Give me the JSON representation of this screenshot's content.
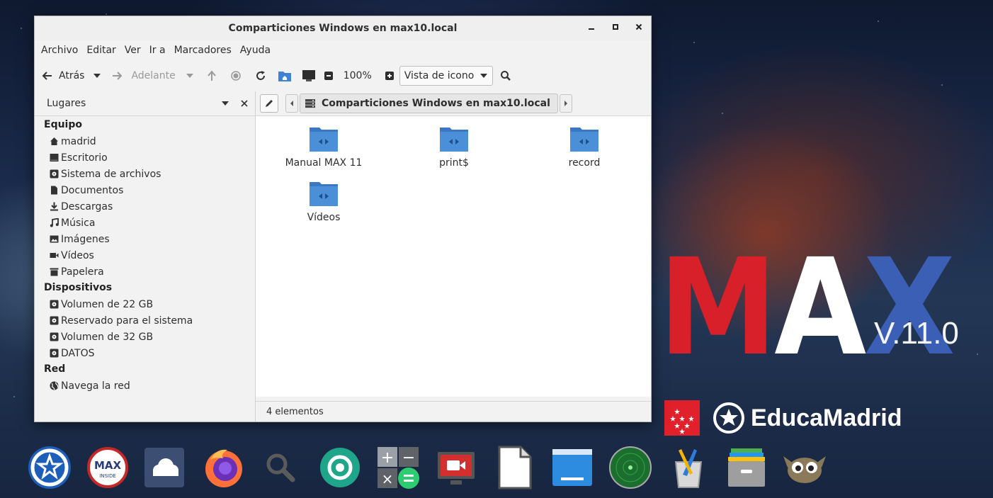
{
  "window": {
    "title": "Comparticiones Windows en max10.local",
    "controls": {
      "minimize": "–",
      "maximize": "▪",
      "close": "×"
    }
  },
  "menubar": [
    "Archivo",
    "Editar",
    "Ver",
    "Ir a",
    "Marcadores",
    "Ayuda"
  ],
  "toolbar": {
    "back_label": "Atrás",
    "forward_label": "Adelante",
    "zoom": "100%",
    "view_mode": "Vista de icono"
  },
  "sidebar": {
    "header": "Lugares",
    "sections": [
      {
        "title": "Equipo",
        "items": [
          {
            "label": "madrid",
            "icon": "home-icon"
          },
          {
            "label": "Escritorio",
            "icon": "desktop-icon"
          },
          {
            "label": "Sistema de archivos",
            "icon": "drive-icon"
          },
          {
            "label": "Documentos",
            "icon": "document-icon"
          },
          {
            "label": "Descargas",
            "icon": "download-icon"
          },
          {
            "label": "Música",
            "icon": "music-icon"
          },
          {
            "label": "Imágenes",
            "icon": "image-icon"
          },
          {
            "label": "Vídeos",
            "icon": "video-icon"
          },
          {
            "label": "Papelera",
            "icon": "trash-icon"
          }
        ]
      },
      {
        "title": "Dispositivos",
        "items": [
          {
            "label": "Volumen de 22 GB",
            "icon": "drive-icon"
          },
          {
            "label": "Reservado para el sistema",
            "icon": "drive-icon"
          },
          {
            "label": "Volumen de 32 GB",
            "icon": "drive-icon"
          },
          {
            "label": "DATOS",
            "icon": "drive-icon"
          }
        ]
      },
      {
        "title": "Red",
        "items": [
          {
            "label": "Navega la red",
            "icon": "globe-icon"
          }
        ]
      }
    ]
  },
  "pathbar": {
    "current": "Comparticiones Windows en max10.local"
  },
  "files": [
    {
      "name": "Manual MAX 11"
    },
    {
      "name": "print$"
    },
    {
      "name": "record"
    },
    {
      "name": "Vídeos"
    }
  ],
  "status": "4 elementos",
  "branding": {
    "logo_letters": [
      "M",
      "A",
      "X"
    ],
    "version": "V.11.0",
    "org": "EducaMadrid",
    "colors": {
      "m": "#d8202a",
      "a": "#ffffff",
      "x": "#3a5fb5",
      "folder": "#4a8fd8"
    }
  },
  "dock": [
    "max-menu-icon",
    "max-inside-icon",
    "nextcloud-icon",
    "firefox-icon",
    "search-icon",
    "camera-app-icon",
    "calculator-icon",
    "screen-recorder-icon",
    "document-viewer-icon",
    "file-manager-icon",
    "radar-icon",
    "drawing-icon",
    "archive-icon",
    "gimp-icon"
  ]
}
